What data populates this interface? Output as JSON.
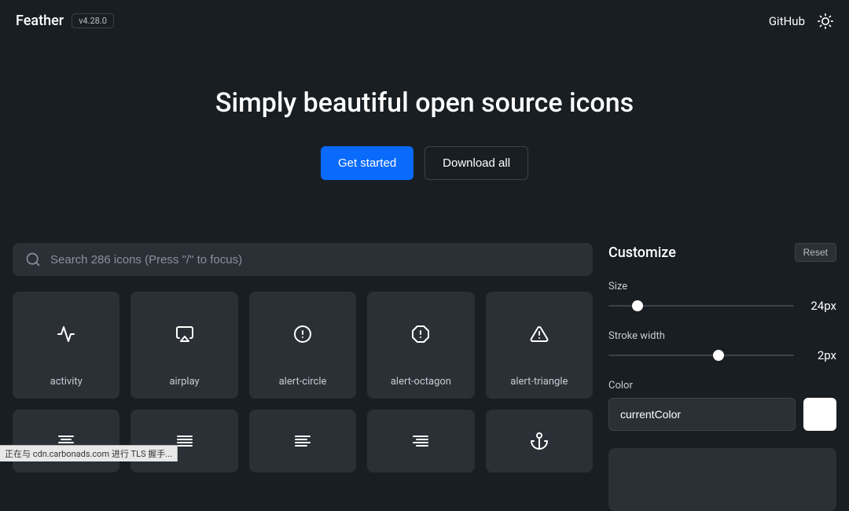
{
  "header": {
    "logo": "Feather",
    "version": "v4.28.0",
    "github": "GitHub"
  },
  "hero": {
    "title": "Simply beautiful open source icons",
    "get_started": "Get started",
    "download_all": "Download all"
  },
  "search": {
    "placeholder": "Search 286 icons (Press \"/\" to focus)"
  },
  "icons": [
    {
      "name": "activity"
    },
    {
      "name": "airplay"
    },
    {
      "name": "alert-circle"
    },
    {
      "name": "alert-octagon"
    },
    {
      "name": "alert-triangle"
    },
    {
      "name": "align-center"
    },
    {
      "name": "align-justify"
    },
    {
      "name": "align-left"
    },
    {
      "name": "align-right"
    },
    {
      "name": "anchor"
    }
  ],
  "customize": {
    "title": "Customize",
    "reset": "Reset",
    "size_label": "Size",
    "size_value": "24px",
    "stroke_label": "Stroke width",
    "stroke_value": "2px",
    "color_label": "Color",
    "color_value": "currentColor"
  },
  "statusbar": "正在与 cdn.carbonads.com 进行 TLS 握手..."
}
